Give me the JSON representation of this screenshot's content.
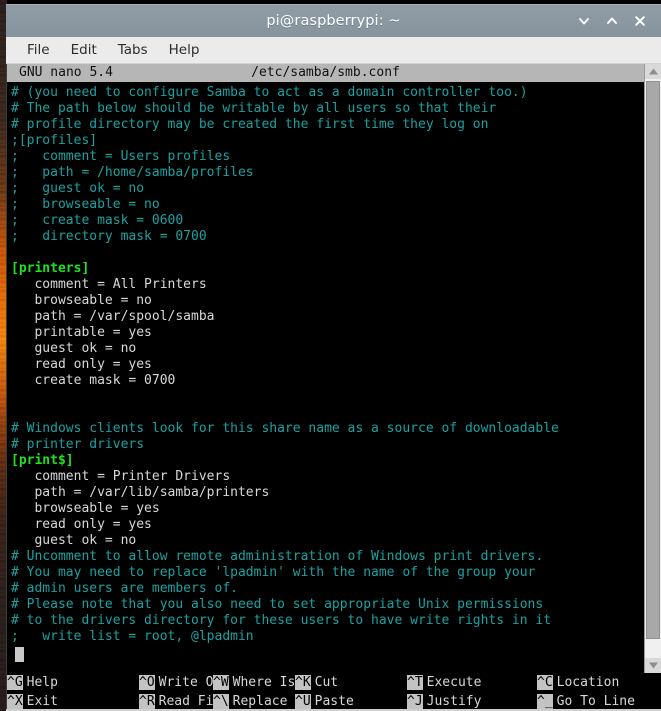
{
  "window": {
    "title": "pi@raspberrypi: ~",
    "controls": [
      {
        "name": "minimize",
        "glyph": "chevron-down"
      },
      {
        "name": "maximize",
        "glyph": "chevron-up"
      },
      {
        "name": "close",
        "glyph": "x"
      }
    ],
    "titlebar_color": "#8b98a1",
    "titlebar_text_color": "#ffffff"
  },
  "menubar": {
    "items": [
      {
        "label": "File"
      },
      {
        "label": "Edit"
      },
      {
        "label": "Tabs"
      },
      {
        "label": "Help"
      }
    ],
    "background_color": "#ebebeb",
    "text_color": "#2c2c2c"
  },
  "nano": {
    "version_label": "GNU nano 5.4",
    "filename": "/etc/samba/smb.conf",
    "header_background": "#b6b6b6",
    "header_text_color": "#111111",
    "comment_color": "#1ba1a1",
    "section_color": "#22e022",
    "text_color": "#d8d8d8",
    "background_color": "#000000",
    "lines": [
      {
        "type": "comment",
        "text": "# (you need to configure Samba to act as a domain controller too.)"
      },
      {
        "type": "comment",
        "text": "# The path below should be writable by all users so that their"
      },
      {
        "type": "comment",
        "text": "# profile directory may be created the first time they log on"
      },
      {
        "type": "comment",
        "text": ";[profiles]"
      },
      {
        "type": "comment",
        "text": ";   comment = Users profiles"
      },
      {
        "type": "comment",
        "text": ";   path = /home/samba/profiles"
      },
      {
        "type": "comment",
        "text": ";   guest ok = no"
      },
      {
        "type": "comment",
        "text": ";   browseable = no"
      },
      {
        "type": "comment",
        "text": ";   create mask = 0600"
      },
      {
        "type": "comment",
        "text": ";   directory mask = 0700"
      },
      {
        "type": "blank",
        "text": ""
      },
      {
        "type": "section",
        "text": "[printers]"
      },
      {
        "type": "text",
        "text": "   comment = All Printers"
      },
      {
        "type": "text",
        "text": "   browseable = no"
      },
      {
        "type": "text",
        "text": "   path = /var/spool/samba"
      },
      {
        "type": "text",
        "text": "   printable = yes"
      },
      {
        "type": "text",
        "text": "   guest ok = no"
      },
      {
        "type": "text",
        "text": "   read only = yes"
      },
      {
        "type": "text",
        "text": "   create mask = 0700"
      },
      {
        "type": "blank",
        "text": ""
      },
      {
        "type": "blank",
        "text": ""
      },
      {
        "type": "comment",
        "text": "# Windows clients look for this share name as a source of downloadable"
      },
      {
        "type": "comment",
        "text": "# printer drivers"
      },
      {
        "type": "section",
        "text": "[print$]"
      },
      {
        "type": "text",
        "text": "   comment = Printer Drivers"
      },
      {
        "type": "text",
        "text": "   path = /var/lib/samba/printers"
      },
      {
        "type": "text",
        "text": "   browseable = yes"
      },
      {
        "type": "text",
        "text": "   read only = yes"
      },
      {
        "type": "text",
        "text": "   guest ok = no"
      },
      {
        "type": "comment",
        "text": "# Uncomment to allow remote administration of Windows print drivers."
      },
      {
        "type": "comment",
        "text": "# You may need to replace 'lpadmin' with the name of the group your"
      },
      {
        "type": "comment",
        "text": "# admin users are members of."
      },
      {
        "type": "comment",
        "text": "# Please note that you also need to set appropriate Unix permissions"
      },
      {
        "type": "comment",
        "text": "# to the drivers directory for these users to have write rights in it"
      },
      {
        "type": "comment",
        "text": ";   write list = root, @lpadmin"
      }
    ],
    "shortcuts_row1": [
      {
        "key": "^G",
        "label": "Help"
      },
      {
        "key": "^O",
        "label": "Write Out"
      },
      {
        "key": "^W",
        "label": "Where Is"
      },
      {
        "key": "^K",
        "label": "Cut"
      },
      {
        "key": "^T",
        "label": "Execute"
      },
      {
        "key": "^C",
        "label": "Location"
      }
    ],
    "shortcuts_row2": [
      {
        "key": "^X",
        "label": "Exit"
      },
      {
        "key": "^R",
        "label": "Read File"
      },
      {
        "key": "^\\",
        "label": "Replace"
      },
      {
        "key": "^U",
        "label": "Paste"
      },
      {
        "key": "^J",
        "label": "Justify"
      },
      {
        "key": "^_",
        "label": "Go To Line"
      }
    ]
  },
  "scrollbar": {
    "up_arrow": "scroll-up",
    "down_arrow": "scroll-down"
  }
}
